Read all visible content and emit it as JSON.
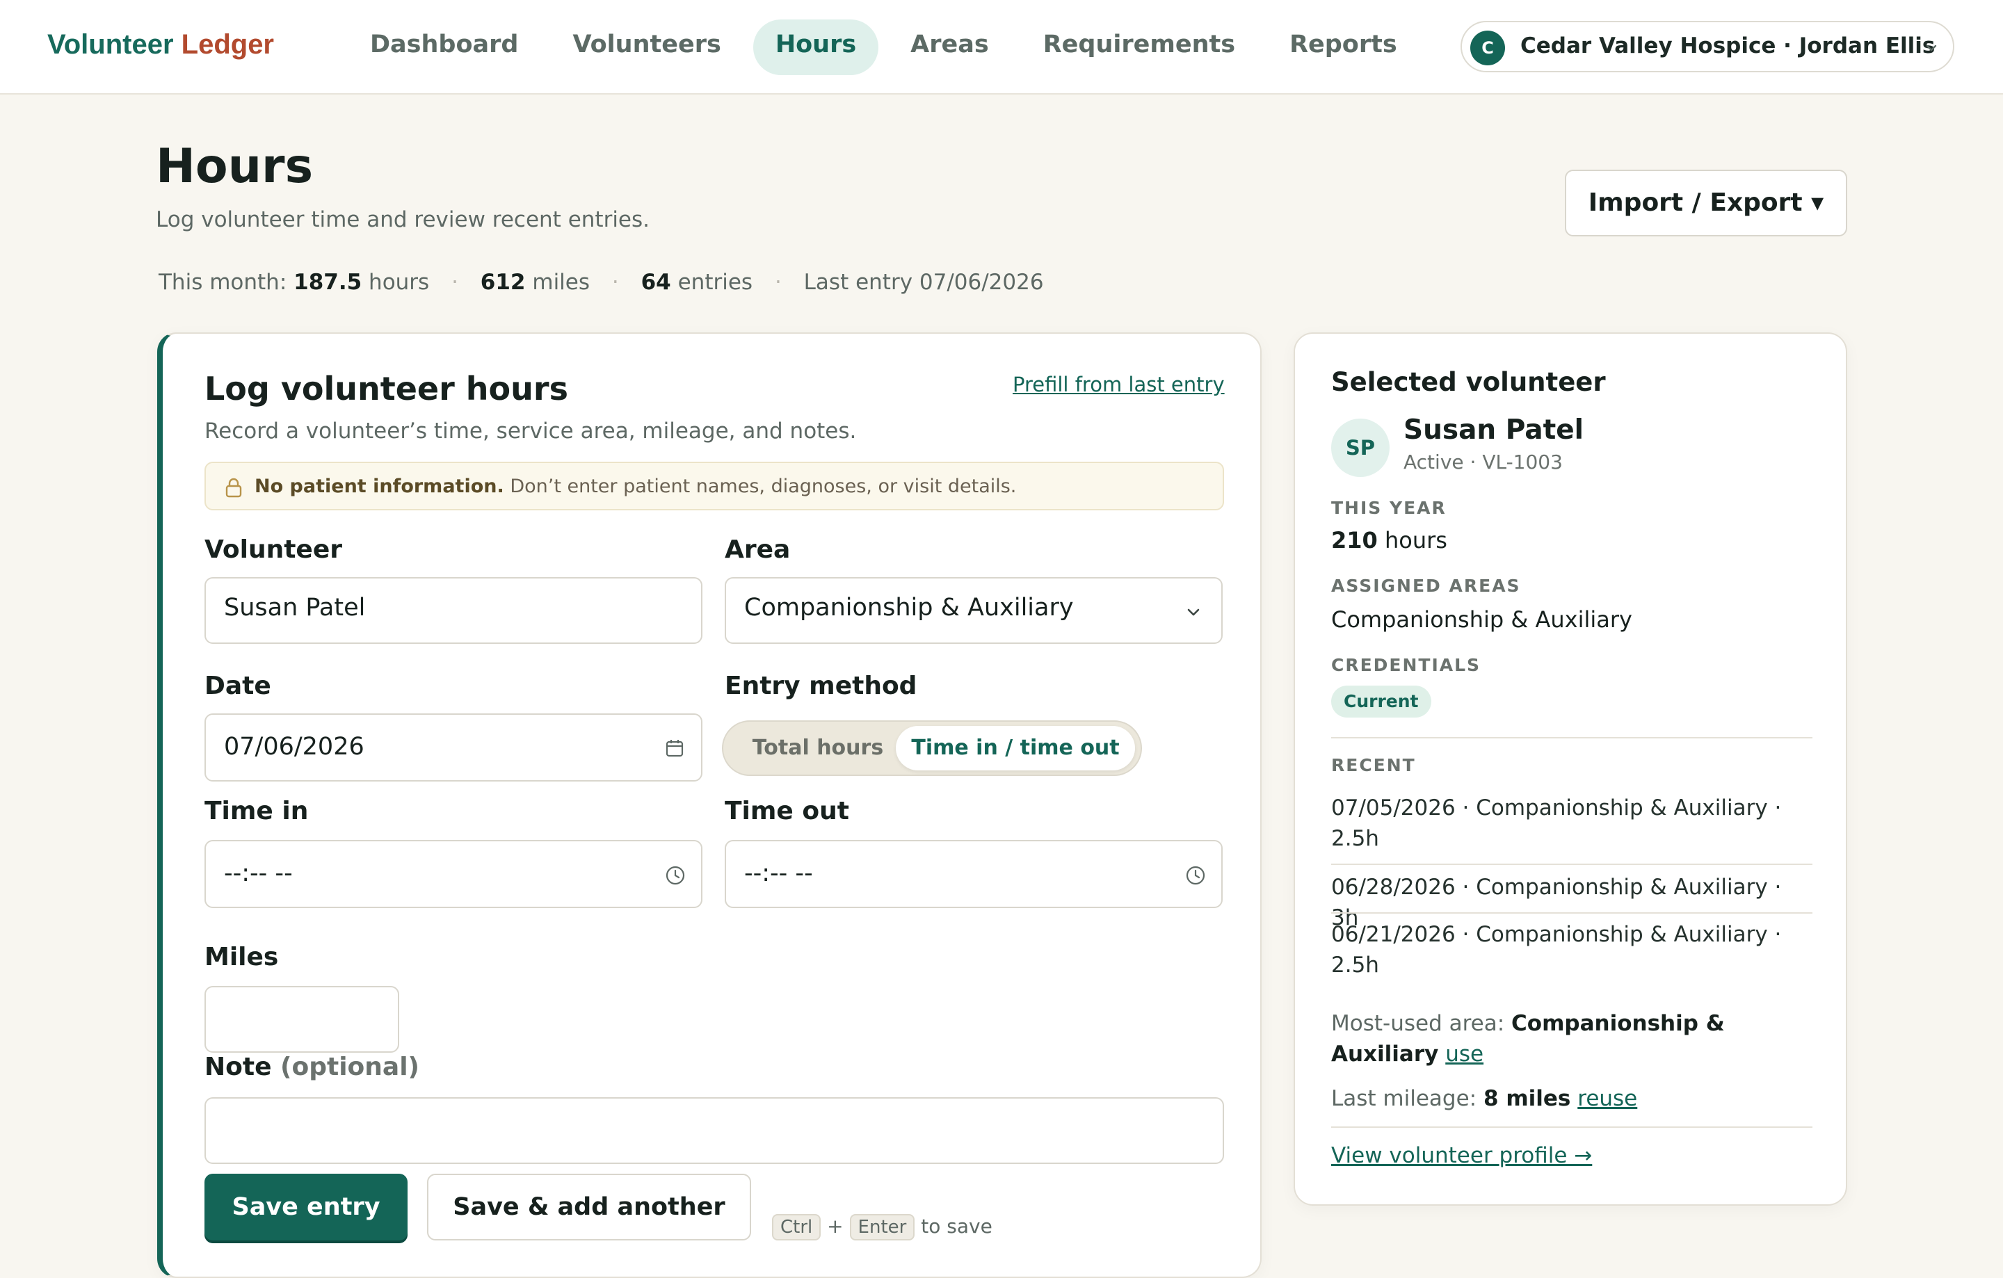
{
  "app": {
    "logo_part1": "Volunteer",
    "logo_part2": "Ledger",
    "brand_color": "#146557",
    "accent_color": "#b24a2e"
  },
  "nav": {
    "items": [
      {
        "label": "Dashboard",
        "active": false
      },
      {
        "label": "Volunteers",
        "active": false
      },
      {
        "label": "Hours",
        "active": true
      },
      {
        "label": "Areas",
        "active": false
      },
      {
        "label": "Requirements",
        "active": false
      },
      {
        "label": "Reports",
        "active": false
      }
    ],
    "org_initial": "C",
    "org_label": "Cedar Valley Hospice · Jordan Ellis",
    "org_chevron_icon": "chevron-down-icon"
  },
  "page": {
    "title": "Hours",
    "subtitle": "Log volunteer time and review recent entries.",
    "import_export_label": "Import / Export ▾"
  },
  "stats": {
    "prefix": "This month:",
    "hours_value": "187.5",
    "hours_unit": "hours",
    "miles_value": "612",
    "miles_unit": "miles",
    "entries_value": "64",
    "entries_unit": "entries",
    "last_entry": "Last entry 07/06/2026"
  },
  "form": {
    "title": "Log volunteer hours",
    "subtitle": "Record a volunteer’s time, service area, mileage, and notes.",
    "prefill_label": "Prefill from last entry",
    "notice_strong": "No patient information.",
    "notice_text": "Don’t enter patient names, diagnoses, or visit details.",
    "notice_icon": "lock-icon",
    "volunteer_label": "Volunteer",
    "volunteer_value": "Susan Patel",
    "area_label": "Area",
    "area_value": "Companionship & Auxiliary",
    "date_label": "Date",
    "date_value": "07/06/2026",
    "entry_method_label": "Entry method",
    "entry_method_options": [
      "Total hours",
      "Time in / time out"
    ],
    "entry_method_selected": "Time in / time out",
    "time_in_label": "Time in",
    "time_in_placeholder": "--:-- --",
    "time_out_label": "Time out",
    "time_out_placeholder": "--:-- --",
    "miles_label": "Miles",
    "miles_value": "",
    "note_label": "Note",
    "note_optional": "(optional)",
    "note_value": "",
    "save_label": "Save entry",
    "save_add_label": "Save & add another",
    "shortcut_key1": "Ctrl",
    "shortcut_plus": "+",
    "shortcut_key2": "Enter",
    "shortcut_suffix": "to save"
  },
  "volunteer_card": {
    "title": "Selected volunteer",
    "initials": "SP",
    "name": "Susan Patel",
    "status": "Active · VL-1003",
    "this_year_label": "THIS YEAR",
    "this_year_value": "210",
    "this_year_unit": "hours",
    "assigned_areas_label": "ASSIGNED AREAS",
    "assigned_areas_value": "Companionship & Auxiliary",
    "credentials_label": "CREDENTIALS",
    "credentials_badge": "Current",
    "recent_label": "RECENT",
    "recent": [
      "07/05/2026 · Companionship & Auxiliary · 2.5h",
      "06/28/2026 · Companionship & Auxiliary · 3h",
      "06/21/2026 · Companionship & Auxiliary · 2.5h"
    ],
    "most_used_prefix": "Most-used area:",
    "most_used_value": "Companionship & Auxiliary",
    "most_used_link": "use",
    "last_mileage_prefix": "Last mileage:",
    "last_mileage_value": "8 miles",
    "last_mileage_link": "reuse",
    "profile_link": "View volunteer profile →"
  }
}
